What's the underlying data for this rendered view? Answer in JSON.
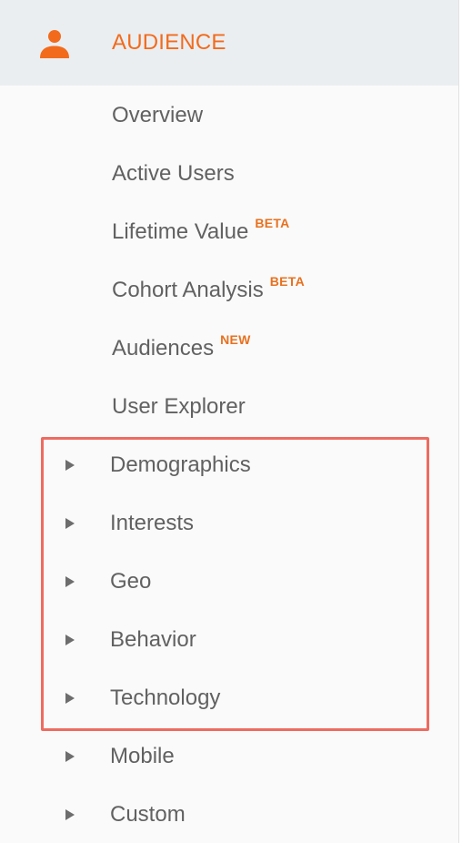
{
  "section": {
    "title": "AUDIENCE",
    "icon": "person-icon",
    "accent_color": "#f26b1d"
  },
  "items": [
    {
      "label": "Overview",
      "badge": ""
    },
    {
      "label": "Active Users",
      "badge": ""
    },
    {
      "label": "Lifetime Value",
      "badge": "BETA"
    },
    {
      "label": "Cohort Analysis",
      "badge": "BETA"
    },
    {
      "label": "Audiences",
      "badge": "NEW"
    },
    {
      "label": "User Explorer",
      "badge": ""
    }
  ],
  "expandable_items": [
    {
      "label": "Demographics",
      "icon": "caret-right-icon"
    },
    {
      "label": "Interests",
      "icon": "caret-right-icon"
    },
    {
      "label": "Geo",
      "icon": "caret-right-icon"
    },
    {
      "label": "Behavior",
      "icon": "caret-right-icon"
    },
    {
      "label": "Technology",
      "icon": "caret-right-icon"
    },
    {
      "label": "Mobile",
      "icon": "caret-right-icon"
    },
    {
      "label": "Custom",
      "icon": "caret-right-icon"
    }
  ],
  "highlight_color": "#ee6b60"
}
